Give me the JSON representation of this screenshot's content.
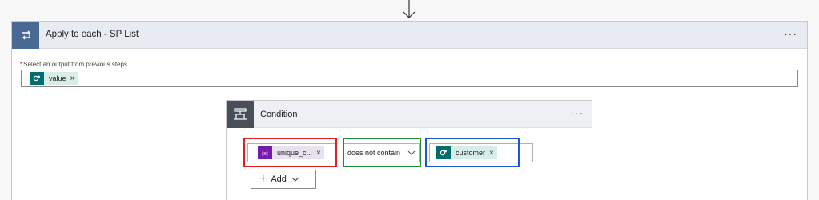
{
  "loop": {
    "title": "Apply to each - SP List",
    "select_label": "Select an output from previous steps",
    "required_mark": "*",
    "token": {
      "label": "value",
      "icon": "sharepoint-icon",
      "remove": "×"
    },
    "menu": "···"
  },
  "condition": {
    "title": "Condition",
    "menu": "···",
    "left_token": {
      "label": "unique_c...",
      "icon": "expression-icon",
      "remove": "×"
    },
    "operator": "does not contain",
    "right_token": {
      "label": "customer",
      "icon": "sharepoint-icon",
      "remove": "×"
    },
    "add_label": "Add"
  },
  "colors": {
    "loop_accent": "#486991",
    "condition_accent": "#484f58",
    "sharepoint": "#036c70",
    "expression": "#7719aa",
    "highlight_red": "#e02020",
    "highlight_green": "#1e8a3a",
    "highlight_blue": "#1a56d6"
  }
}
